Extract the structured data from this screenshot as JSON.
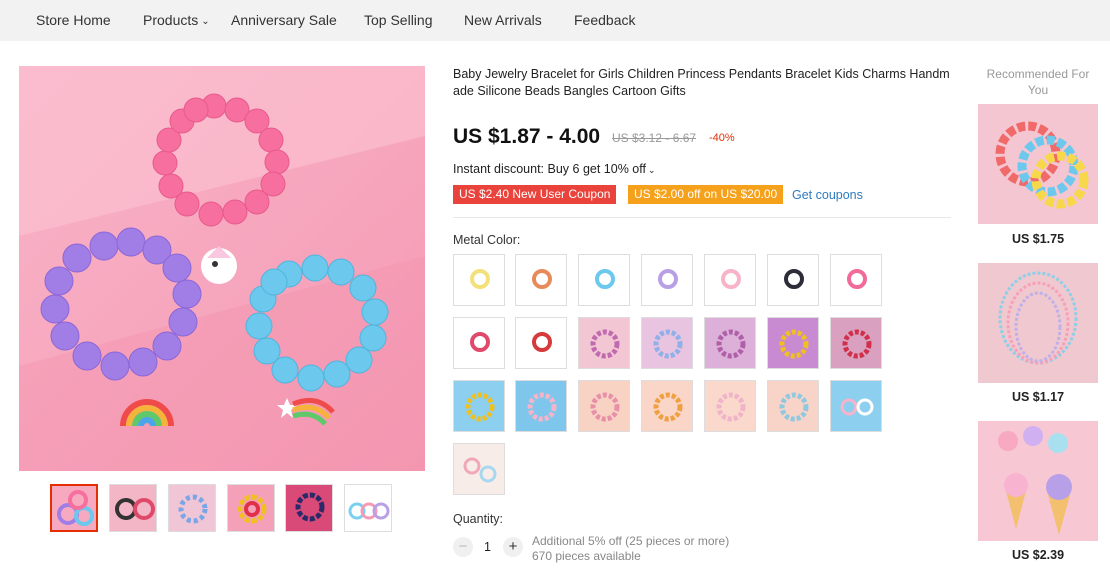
{
  "nav": {
    "items": [
      {
        "label": "Store Home"
      },
      {
        "label": "Products"
      },
      {
        "label": "Anniversary Sale"
      },
      {
        "label": "Top Selling"
      },
      {
        "label": "New Arrivals"
      },
      {
        "label": "Feedback"
      }
    ],
    "products_icon": "chevron-down-icon"
  },
  "gallery": {
    "thumbnail_count": 6,
    "selected_index": 0
  },
  "product": {
    "title": "Baby Jewelry Bracelet for Girls Children Princess Pendants Bracelet Kids Charms Handmade Silicone Beads Bangles Cartoon Gifts",
    "price": "US $1.87 - 4.00",
    "original_price": "US $3.12 - 6.67",
    "discount": "-40%",
    "instant_discount": "Instant discount: Buy 6 get 10% off",
    "coupon_new_user": "US $2.40 New User Coupon",
    "coupon_store": "US $2.00 off on US $20.00",
    "get_coupons": "Get coupons",
    "metal_color_label": "Metal Color:",
    "quantity_label": "Quantity:",
    "quantity_value": "1",
    "quantity_note": "Additional 5% off (25 pieces or more)",
    "availability": "670 pieces available"
  },
  "colors": {
    "accent_red": "#e62e04",
    "coupon_red": "#e9433b",
    "coupon_orange": "#f6a11b",
    "link_blue": "#2e7bbf"
  },
  "recommended": {
    "title": "Recommended For You",
    "items": [
      {
        "price": "US $1.75"
      },
      {
        "price": "US $1.17"
      },
      {
        "price": "US $2.39"
      }
    ]
  }
}
